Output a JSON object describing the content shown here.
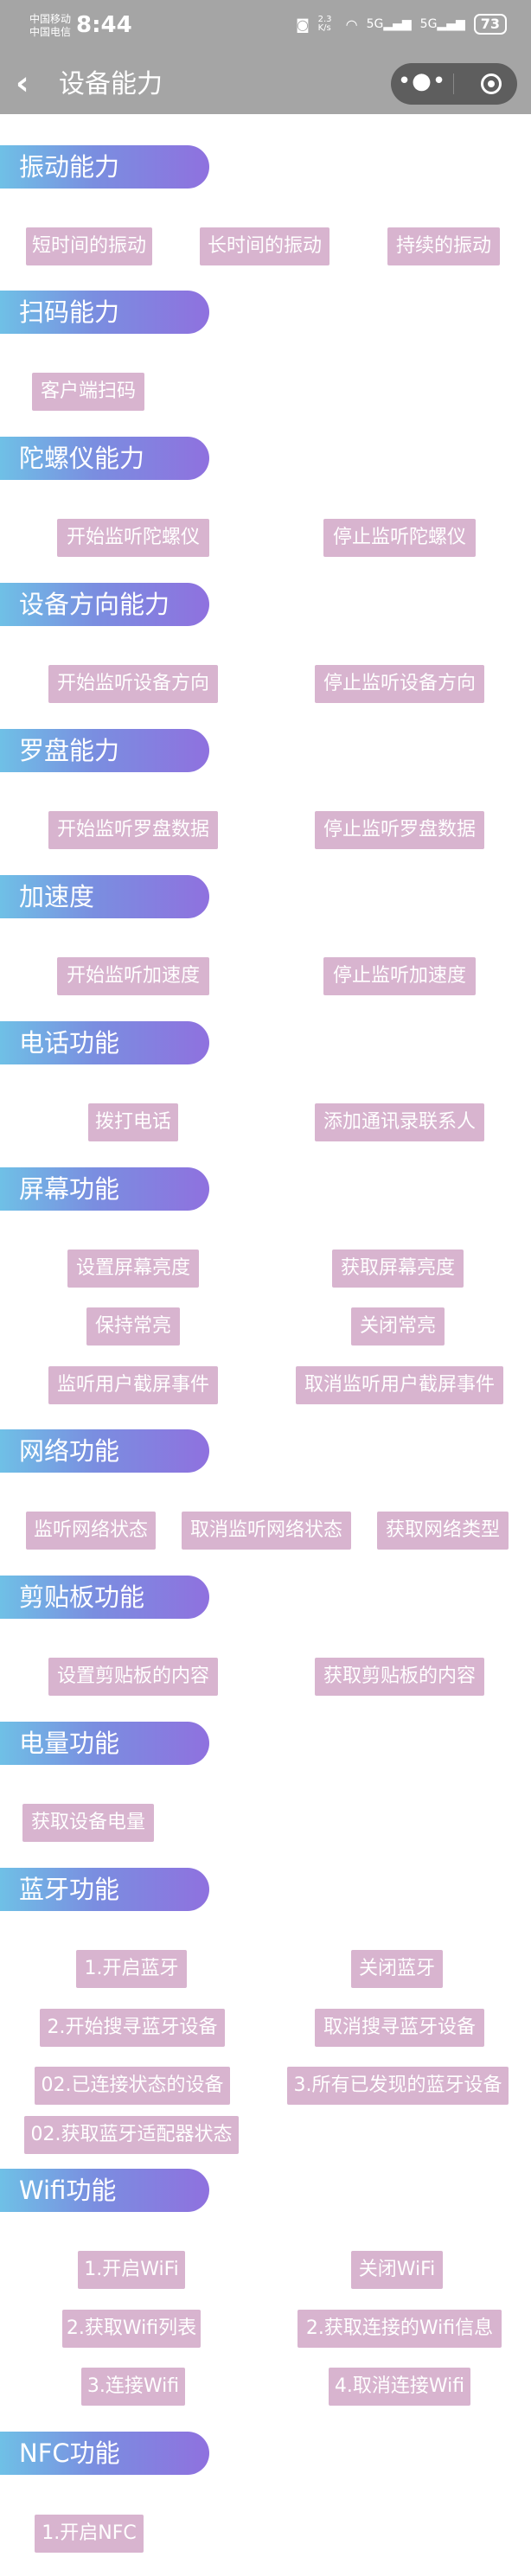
{
  "status_bar": {
    "carrier1": "中国移动",
    "carrier2": "中国电信",
    "time": "8:44",
    "net_speed": "2.3 K/s",
    "signal1": "5G",
    "signal2": "5G",
    "battery": "73"
  },
  "nav": {
    "back_icon": "chevron-left-icon",
    "title": "设备能力",
    "more_icon": "more-dots-icon",
    "close_icon": "target-icon"
  },
  "sections": [
    {
      "title": "振动能力",
      "buttons": [
        "短时间的振动",
        "长时间的振动",
        "持续的振动"
      ]
    },
    {
      "title": "扫码能力",
      "buttons": [
        "客户端扫码"
      ]
    },
    {
      "title": "陀螺仪能力",
      "buttons": [
        "开始监听陀螺仪",
        "停止监听陀螺仪"
      ]
    },
    {
      "title": "设备方向能力",
      "buttons": [
        "开始监听设备方向",
        "停止监听设备方向"
      ]
    },
    {
      "title": "罗盘能力",
      "buttons": [
        "开始监听罗盘数据",
        "停止监听罗盘数据"
      ]
    },
    {
      "title": "加速度",
      "buttons": [
        "开始监听加速度",
        "停止监听加速度"
      ]
    },
    {
      "title": "电话功能",
      "buttons": [
        "拨打电话",
        "添加通讯录联系人"
      ]
    },
    {
      "title": "屏幕功能",
      "buttons": [
        "设置屏幕亮度",
        "获取屏幕亮度",
        "保持常亮",
        "关闭常亮",
        "监听用户截屏事件",
        "取消监听用户截屏事件"
      ]
    },
    {
      "title": "网络功能",
      "buttons": [
        "监听网络状态",
        "取消监听网络状态",
        "获取网络类型"
      ]
    },
    {
      "title": "剪贴板功能",
      "buttons": [
        "设置剪贴板的内容",
        "获取剪贴板的内容"
      ]
    },
    {
      "title": "电量功能",
      "buttons": [
        "获取设备电量"
      ]
    },
    {
      "title": "蓝牙功能",
      "buttons": [
        "1.开启蓝牙",
        "关闭蓝牙",
        "2.开始搜寻蓝牙设备",
        "取消搜寻蓝牙设备",
        "02.已连接状态的设备",
        "3.所有已发现的蓝牙设备",
        "02.获取蓝牙适配器状态"
      ]
    },
    {
      "title": "Wifi功能",
      "buttons": [
        "1.开启WiFi",
        "关闭WiFi",
        "2.获取Wifi列表",
        "2.获取连接的Wifi信息",
        "3.连接Wifi",
        "4.取消连接Wifi"
      ]
    },
    {
      "title": "NFC功能",
      "buttons": [
        "1.开启NFC"
      ]
    }
  ]
}
